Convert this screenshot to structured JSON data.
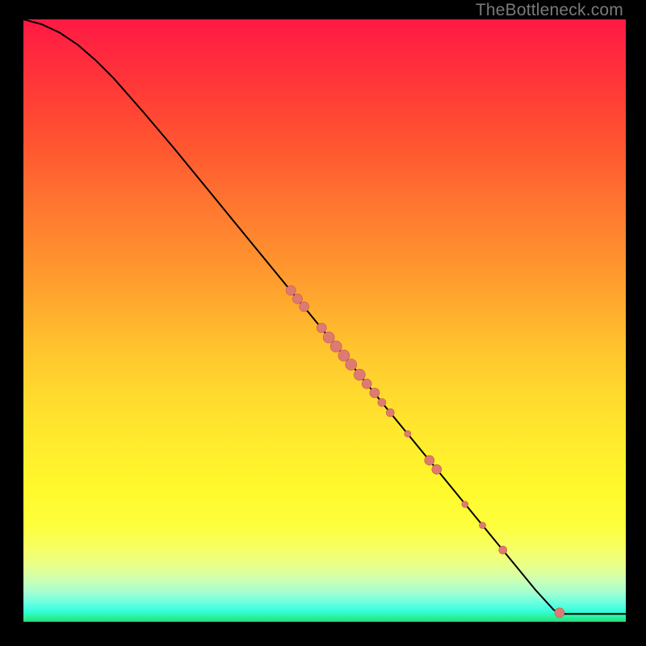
{
  "watermark": "TheBottleneck.com",
  "colors": {
    "page_bg": "#000000",
    "curve_stroke": "#000000",
    "marker_fill": "#dd7b72",
    "marker_stroke": "#c2564e"
  },
  "chart_data": {
    "type": "line",
    "title": "",
    "xlabel": "",
    "ylabel": "",
    "xlim": [
      0,
      100
    ],
    "ylim": [
      0,
      100
    ],
    "grid": false,
    "curve_points": [
      {
        "x": 0,
        "y": 100
      },
      {
        "x": 3,
        "y": 99.2
      },
      {
        "x": 6,
        "y": 97.8
      },
      {
        "x": 9,
        "y": 95.8
      },
      {
        "x": 12,
        "y": 93.2
      },
      {
        "x": 15,
        "y": 90.2
      },
      {
        "x": 20,
        "y": 84.5
      },
      {
        "x": 25,
        "y": 78.6
      },
      {
        "x": 30,
        "y": 72.5
      },
      {
        "x": 35,
        "y": 66.4
      },
      {
        "x": 40,
        "y": 60.3
      },
      {
        "x": 45,
        "y": 54.2
      },
      {
        "x": 50,
        "y": 48.1
      },
      {
        "x": 55,
        "y": 42.0
      },
      {
        "x": 60,
        "y": 35.8
      },
      {
        "x": 65,
        "y": 29.7
      },
      {
        "x": 70,
        "y": 23.6
      },
      {
        "x": 75,
        "y": 17.5
      },
      {
        "x": 80,
        "y": 11.4
      },
      {
        "x": 85,
        "y": 5.3
      },
      {
        "x": 88,
        "y": 2.0
      },
      {
        "x": 89.3,
        "y": 1.3
      },
      {
        "x": 100,
        "y": 1.3
      }
    ],
    "markers": [
      {
        "x": 44.4,
        "y": 55.0,
        "r": 6
      },
      {
        "x": 45.5,
        "y": 53.6,
        "r": 6
      },
      {
        "x": 46.6,
        "y": 52.3,
        "r": 6
      },
      {
        "x": 49.5,
        "y": 48.8,
        "r": 6
      },
      {
        "x": 50.7,
        "y": 47.2,
        "r": 7
      },
      {
        "x": 51.9,
        "y": 45.7,
        "r": 7
      },
      {
        "x": 53.2,
        "y": 44.2,
        "r": 7
      },
      {
        "x": 54.4,
        "y": 42.7,
        "r": 7
      },
      {
        "x": 55.8,
        "y": 41.0,
        "r": 7
      },
      {
        "x": 57.0,
        "y": 39.5,
        "r": 6
      },
      {
        "x": 58.3,
        "y": 38.0,
        "r": 6
      },
      {
        "x": 59.5,
        "y": 36.4,
        "r": 5
      },
      {
        "x": 60.9,
        "y": 34.7,
        "r": 5
      },
      {
        "x": 63.8,
        "y": 31.2,
        "r": 4
      },
      {
        "x": 67.4,
        "y": 26.8,
        "r": 6
      },
      {
        "x": 68.6,
        "y": 25.3,
        "r": 6
      },
      {
        "x": 73.3,
        "y": 19.5,
        "r": 4
      },
      {
        "x": 76.2,
        "y": 16.0,
        "r": 4
      },
      {
        "x": 79.6,
        "y": 11.9,
        "r": 5
      },
      {
        "x": 89.0,
        "y": 1.5,
        "r": 6
      }
    ]
  }
}
